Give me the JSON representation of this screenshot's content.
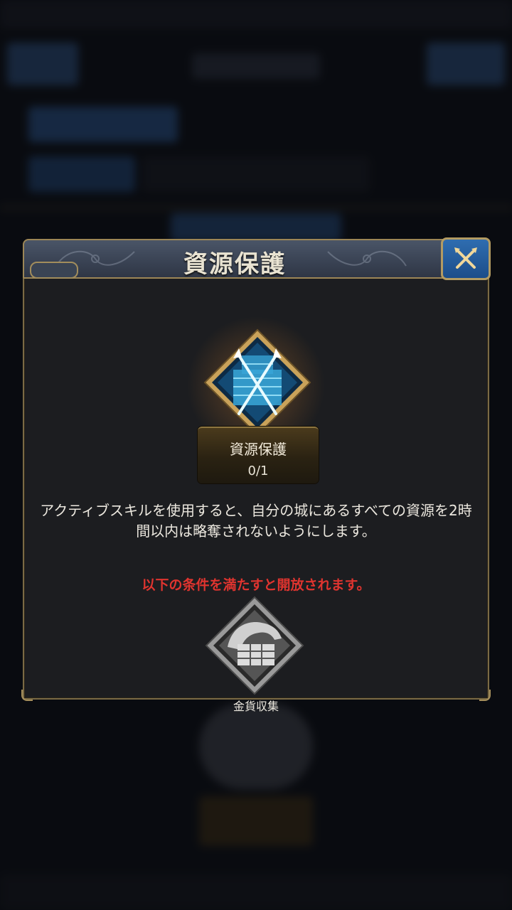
{
  "dialog": {
    "title": "資源保護",
    "close_icon": "close-x-icon"
  },
  "skill": {
    "icon": "crossed-spears-crates-icon",
    "name": "資源保護",
    "level": "0/1",
    "description": "アクティブスキルを使用すると、自分の城にあるすべての資源を2時間以内は略奪されないようにします。"
  },
  "unlock": {
    "condition_text": "以下の条件を満たすと開放されます。",
    "required_skill": {
      "icon": "gold-collection-icon",
      "name": "金貨収集"
    }
  },
  "colors": {
    "condition_red": "#e0342f",
    "gold_border": "#9c8656",
    "close_blue": "#2f6db0",
    "skill_cyan": "#6fe3ff"
  }
}
